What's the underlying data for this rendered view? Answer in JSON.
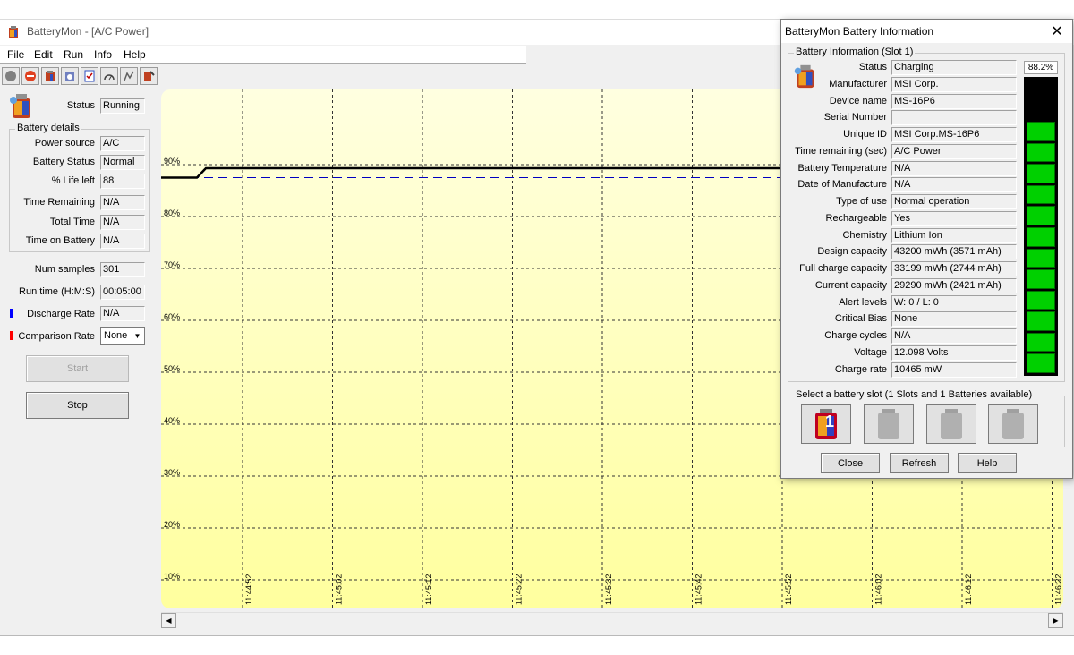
{
  "window": {
    "title": "BatteryMon - [A/C Power]"
  },
  "menu": [
    "File",
    "Edit",
    "Run",
    "Info",
    "Help"
  ],
  "toolbar": [
    "stop-icon",
    "record-icon",
    "battery-icon",
    "info-icon",
    "checklist-icon",
    "gauge-icon",
    "graph-icon",
    "settings-icon"
  ],
  "status": {
    "label": "Status",
    "value": "Running"
  },
  "battery_details": {
    "title": "Battery details",
    "rows": [
      {
        "label": "Power source",
        "value": "A/C"
      },
      {
        "label": "Battery Status",
        "value": "Normal"
      },
      {
        "label": "% Life left",
        "value": "88"
      },
      {
        "label": "Time Remaining",
        "value": "N/A"
      },
      {
        "label": "Total Time",
        "value": "N/A"
      },
      {
        "label": "Time on Battery",
        "value": "N/A"
      }
    ]
  },
  "stats": [
    {
      "label": "Num samples",
      "value": "301"
    },
    {
      "label": "Run time (H:M:S)",
      "value": "00:05:00"
    },
    {
      "label": "Discharge Rate",
      "value": "N/A"
    }
  ],
  "comparison": {
    "label": "Comparison Rate",
    "selected": "None"
  },
  "buttons": {
    "start": "Start",
    "stop": "Stop"
  },
  "colors": {
    "discharge": "#0000ff",
    "comparison": "#ff0000",
    "chart_line": "#000000",
    "chart_ref": "#0000c0",
    "battery_fill": "#00d000"
  },
  "chart_data": {
    "type": "line",
    "y_ticks": [
      "90%",
      "80%",
      "70%",
      "60%",
      "50%",
      "40%",
      "30%",
      "20%",
      "10%"
    ],
    "x_ticks": [
      "11:44:52",
      "11:45:02",
      "11:45:12",
      "11:45:22",
      "11:45:32",
      "11:45:42",
      "11:45:52",
      "11:46:02",
      "11:46:12",
      "11:46:22"
    ],
    "ylim": [
      5,
      95
    ],
    "series": [
      {
        "x": [
          0,
          40,
          50,
          1008
        ],
        "values": [
          87.5,
          87.5,
          89.3,
          89.3
        ]
      }
    ],
    "reference": {
      "value": 87.5
    },
    "grid": true
  },
  "dialog": {
    "title": "BatteryMon Battery Information",
    "group_title": "Battery Information (Slot 1)",
    "percent": "88.2%",
    "percent_value": 0.882,
    "rows": [
      {
        "label": "Status",
        "value": "Charging"
      },
      {
        "label": "Manufacturer",
        "value": "MSI Corp."
      },
      {
        "label": "Device name",
        "value": "MS-16P6"
      },
      {
        "label": "Serial Number",
        "value": ""
      },
      {
        "label": "Unique ID",
        "value": "MSI Corp.MS-16P6"
      },
      {
        "label": "Time remaining (sec)",
        "value": "A/C Power"
      },
      {
        "label": "Battery Temperature",
        "value": "N/A"
      },
      {
        "label": "Date of Manufacture",
        "value": "N/A"
      },
      {
        "label": "Type of use",
        "value": "Normal operation"
      },
      {
        "label": "Rechargeable",
        "value": "Yes"
      },
      {
        "label": "Chemistry",
        "value": "Lithium Ion"
      },
      {
        "label": "Design capacity",
        "value": "43200 mWh (3571 mAh)"
      },
      {
        "label": "Full charge capacity",
        "value": "33199 mWh (2744 mAh)"
      },
      {
        "label": "Current capacity",
        "value": "29290 mWh (2421 mAh)"
      },
      {
        "label": "Alert levels",
        "value": "W: 0 / L: 0"
      },
      {
        "label": "Critical Bias",
        "value": "None"
      },
      {
        "label": "Charge cycles",
        "value": "N/A"
      },
      {
        "label": "Voltage",
        "value": "12.098 Volts"
      },
      {
        "label": "Charge rate",
        "value": "10465 mW"
      }
    ],
    "slot_group_title": "Select a battery slot (1 Slots and 1 Batteries available)",
    "slot_badge": "1",
    "buttons": {
      "close": "Close",
      "refresh": "Refresh",
      "help": "Help"
    }
  }
}
